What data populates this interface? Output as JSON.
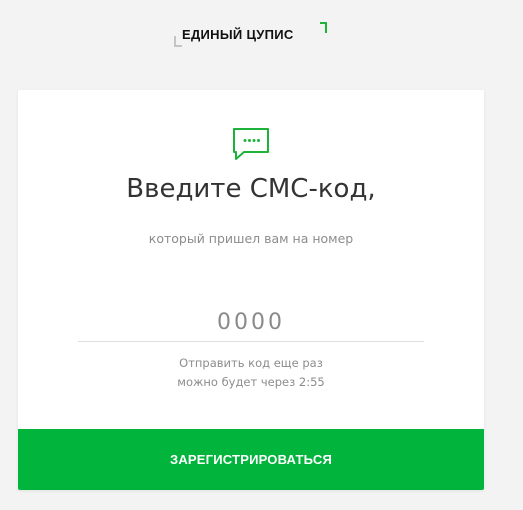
{
  "logo": {
    "text": "ЕДИНЫЙ ЦУПИС"
  },
  "card": {
    "icon": "sms-chat-icon",
    "title": "Введите СМС-код,",
    "subtitle": "который пришел вам на номер",
    "code_input": {
      "value": "",
      "placeholder": "0000"
    },
    "resend": {
      "line1": "Отправить код еще раз",
      "line2": "можно будет через 2:55"
    },
    "submit_label": "ЗАРЕГИСТРИРОВАТЬСЯ"
  },
  "colors": {
    "accent": "#00b43c",
    "background": "#f3f3f3",
    "card": "#ffffff"
  }
}
